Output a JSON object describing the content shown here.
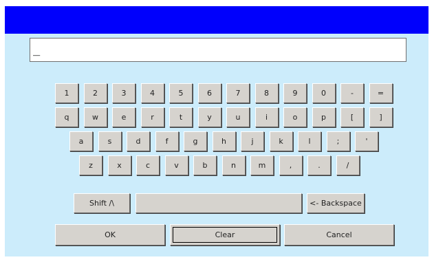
{
  "titlebar": {
    "color": "#0000fc"
  },
  "input": {
    "value": "_"
  },
  "keys": {
    "row1": [
      "1",
      "2",
      "3",
      "4",
      "5",
      "6",
      "7",
      "8",
      "9",
      "0",
      "-",
      "="
    ],
    "row2": [
      "q",
      "w",
      "e",
      "r",
      "t",
      "y",
      "u",
      "i",
      "o",
      "p",
      "[",
      "]"
    ],
    "row3": [
      "a",
      "s",
      "d",
      "f",
      "g",
      "h",
      "j",
      "k",
      "l",
      ";",
      "'"
    ],
    "row4": [
      "z",
      "x",
      "c",
      "v",
      "b",
      "n",
      "m",
      ",",
      ".",
      "/"
    ]
  },
  "controls": {
    "shift": "Shift /\\",
    "backspace": "<- Backspace",
    "ok": "OK",
    "clear": "Clear",
    "cancel": "Cancel"
  },
  "colors": {
    "background": "#ccecfb",
    "key_face": "#d6d3ce"
  }
}
